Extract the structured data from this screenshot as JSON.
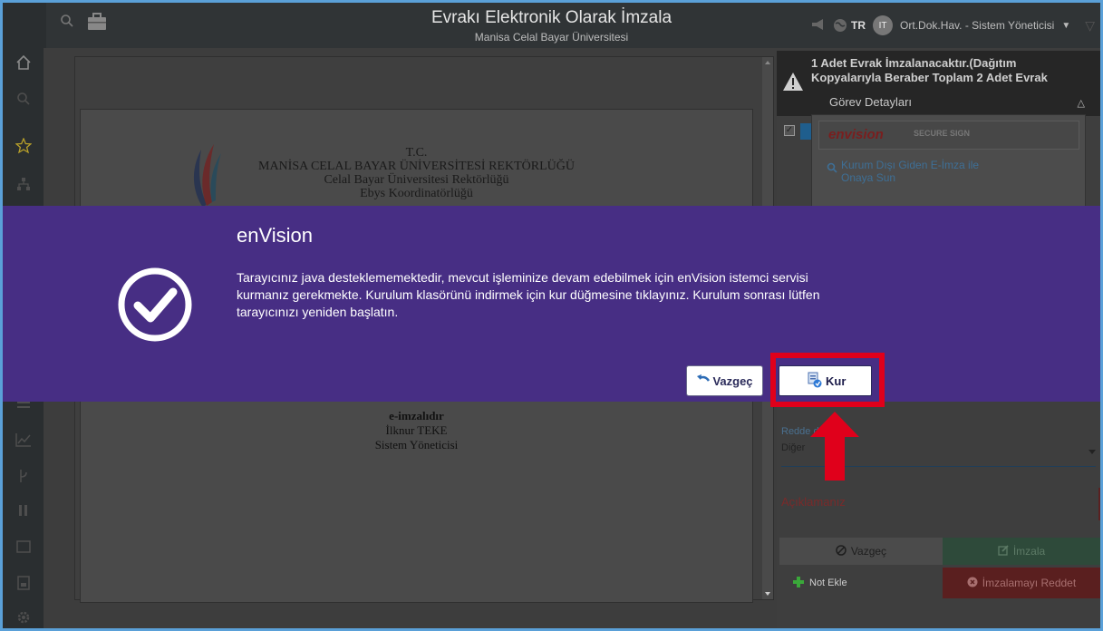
{
  "header": {
    "title": "Evrakı Elektronik Olarak İmzala",
    "subtitle": "Manisa Celal Bayar Üniversitesi",
    "language": "TR",
    "avatar_initials": "IT",
    "user": "Ort.Dok.Hav. - Sistem Yöneticisi"
  },
  "document": {
    "org_line1": "T.C.",
    "org_line2": "MANİSA CELAL BAYAR ÜNİVERSİTESİ REKTÖRLÜĞÜ",
    "org_line3": "Celal Bayar Üniversitesi Rektörlüğü",
    "org_line4": "Ebys Koordinatörlüğü",
    "signature_label": "e-imzalıdır",
    "signer_name": "İlknur TEKE",
    "signer_title": "Sistem Yöneticisi"
  },
  "side_panel": {
    "alert_message": "1 Adet Evrak İmzalanacaktır.(Dağıtım Kopyalarıyla Beraber Toplam 2 Adet Evrak",
    "task_details": "Görev Detayları",
    "brand_logo_text": "envision",
    "secure_sign_text": "SECURE SIGN",
    "menu_item": "Kurum Dışı Giden E-İmza ile Onaya Sun",
    "reason_label": "Reddetme Nedeni",
    "reason_label_visible": "Redde          deni",
    "reason_value": "Diğer",
    "comment_label": "Açıklamanız",
    "cancel_button": "Vazgeç",
    "sign_button": "İmzala",
    "add_note": "Not Ekle",
    "reject_button": "İmzalamayı Reddet"
  },
  "modal": {
    "title": "enVision",
    "message": "Tarayıcınız java desteklememektedir, mevcut işleminize devam edebilmek için enVision istemci servisi kurmanız gerekmekte. Kurulum klasörünü indirmek için kur düğmesine tıklayınız. Kurulum sonrası lütfen tarayıcınızı yeniden başlatın.",
    "cancel_label": "Vazgeç",
    "install_label": "Kur"
  },
  "colors": {
    "modal_bg": "#472e84",
    "highlight": "#e0001b",
    "topbar_bg": "#303436"
  }
}
